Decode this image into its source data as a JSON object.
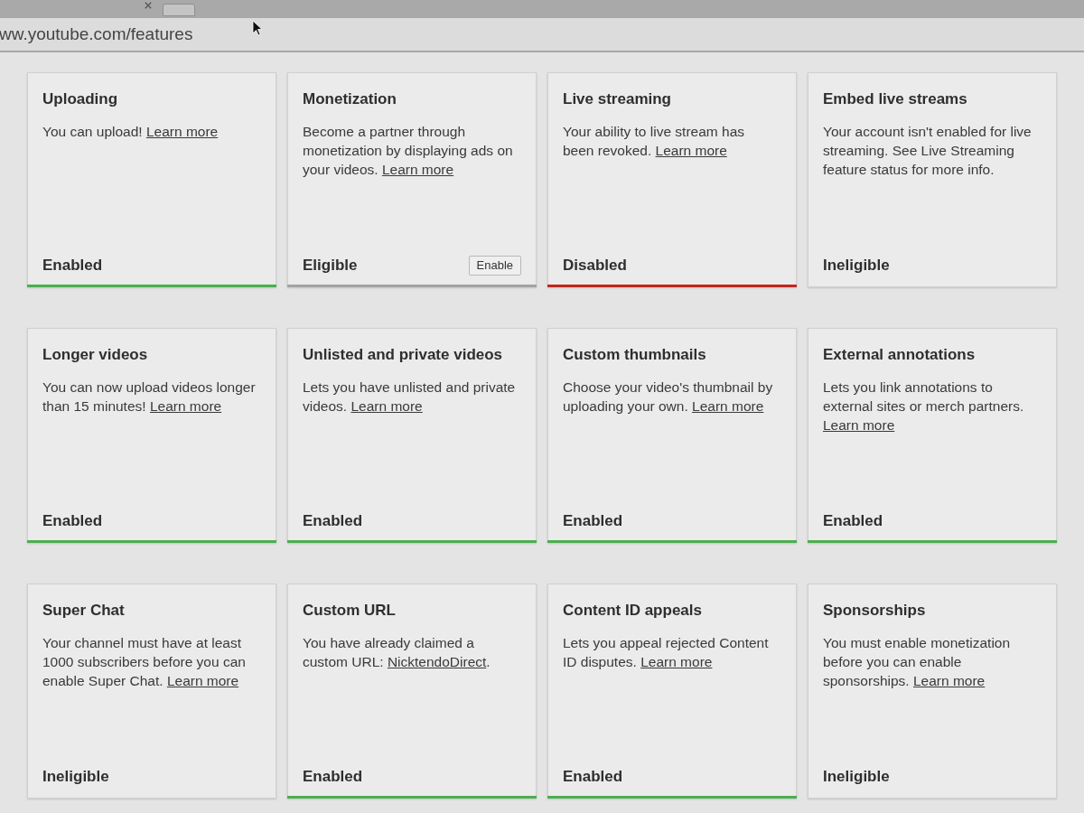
{
  "browser": {
    "url": "ww.youtube.com/features"
  },
  "cards": [
    {
      "title": "Uploading",
      "text": "You can upload!",
      "link": "Learn more",
      "status": {
        "label": "Enabled",
        "kind": "enabled"
      }
    },
    {
      "title": "Monetization",
      "text": "Become a partner through monetization by displaying ads on your videos.",
      "link": "Learn more",
      "status": {
        "label": "Eligible",
        "kind": "eligible"
      },
      "action": "Enable"
    },
    {
      "title": "Live streaming",
      "text": "Your ability to live stream has been revoked.",
      "link": "Learn more",
      "status": {
        "label": "Disabled",
        "kind": "disabled"
      }
    },
    {
      "title": "Embed live streams",
      "text": "Your account isn't enabled for live streaming. See Live Streaming feature status for more info.",
      "status": {
        "label": "Ineligible",
        "kind": "ineligible"
      }
    },
    {
      "title": "Longer videos",
      "text": "You can now upload videos longer than 15 minutes!",
      "link": "Learn more",
      "status": {
        "label": "Enabled",
        "kind": "enabled"
      }
    },
    {
      "title": "Unlisted and private videos",
      "text": "Lets you have unlisted and private videos.",
      "link": "Learn more",
      "status": {
        "label": "Enabled",
        "kind": "enabled"
      }
    },
    {
      "title": "Custom thumbnails",
      "text": "Choose your video's thumbnail by uploading your own.",
      "link": "Learn more",
      "status": {
        "label": "Enabled",
        "kind": "enabled"
      }
    },
    {
      "title": "External annotations",
      "text": "Lets you link annotations to external sites or merch partners.",
      "link": "Learn more",
      "status": {
        "label": "Enabled",
        "kind": "enabled"
      }
    },
    {
      "title": "Super Chat",
      "text": "Your channel must have at least 1000 subscribers before you can enable Super Chat.",
      "link": "Learn more",
      "status": {
        "label": "Ineligible",
        "kind": "ineligible"
      }
    },
    {
      "title": "Custom URL",
      "text": "You have already claimed a custom URL:",
      "link": "NicktendoDirect",
      "after": ".",
      "status": {
        "label": "Enabled",
        "kind": "enabled"
      }
    },
    {
      "title": "Content ID appeals",
      "text": "Lets you appeal rejected Content ID disputes.",
      "link": "Learn more",
      "status": {
        "label": "Enabled",
        "kind": "enabled"
      }
    },
    {
      "title": "Sponsorships",
      "text": "You must enable monetization before you can enable sponsorships.",
      "link": "Learn more",
      "status": {
        "label": "Ineligible",
        "kind": "ineligible"
      }
    }
  ]
}
